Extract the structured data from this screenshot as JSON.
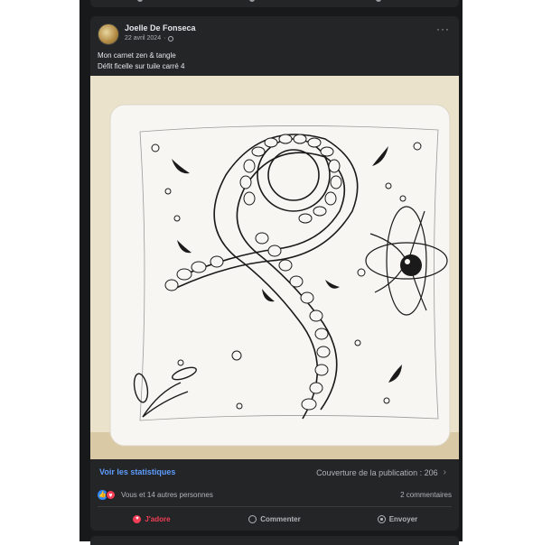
{
  "post": {
    "author": "Joelle De Fonseca",
    "date": "22 avril 2024",
    "more_icon": "more-horizontal-icon",
    "privacy_icon": "globe-icon",
    "text_line1": "Mon carnet zen & tangle",
    "text_line2": "Défit ficelle sur tuile carré 4"
  },
  "stats": {
    "link_label": "Voir les statistiques",
    "reach_label": "Couverture de la publication : 206"
  },
  "reactions": {
    "summary": "Vous et 14 autres personnes",
    "comments": "2 commentaires",
    "icons": [
      "like-icon",
      "love-icon"
    ]
  },
  "actions": {
    "love_label": "J'adore",
    "comment_label": "Commenter",
    "send_label": "Envoyer"
  },
  "colors": {
    "background": "#18191a",
    "card": "#242526",
    "text_primary": "#e4e6eb",
    "text_secondary": "#b0b3b8",
    "link": "#5e9cff",
    "love": "#f33e58",
    "like": "#2d88ff"
  }
}
